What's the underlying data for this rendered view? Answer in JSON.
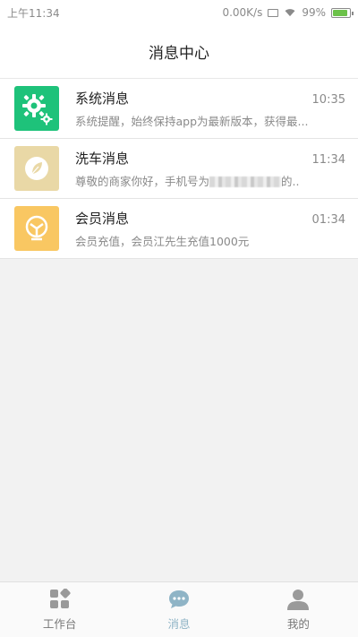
{
  "status_bar": {
    "time": "上午11:34",
    "net_speed": "0.00K/s",
    "battery": "99%"
  },
  "header": {
    "title": "消息中心"
  },
  "messages": [
    {
      "title": "系统消息",
      "time": "10:35",
      "preview": "系统提醒，始终保持app为最新版本，获得最...",
      "icon": "gear-icon",
      "color": "#1ec27a"
    },
    {
      "title": "洗车消息",
      "time": "11:34",
      "preview_prefix": "尊敬的商家你好，手机号为",
      "preview_suffix": "的..",
      "icon": "leaf-icon",
      "color": "#e9d8a6"
    },
    {
      "title": "会员消息",
      "time": "01:34",
      "preview": "会员充值，会员江先生充值1000元",
      "icon": "member-icon",
      "color": "#f9c762"
    }
  ],
  "tabbar": {
    "tabs": [
      {
        "label": "工作台",
        "icon": "grid-icon",
        "active": false
      },
      {
        "label": "消息",
        "icon": "chat-icon",
        "active": true
      },
      {
        "label": "我的",
        "icon": "user-icon",
        "active": false
      }
    ],
    "colors": {
      "active": "#8fb4c6",
      "inactive": "#9a9a9a"
    }
  }
}
